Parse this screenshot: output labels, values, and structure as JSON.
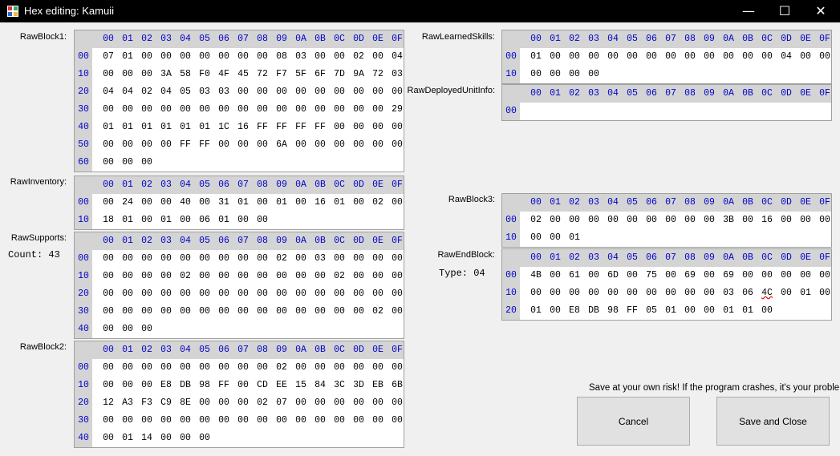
{
  "window": {
    "title": "Hex editing: Kamuii",
    "minimize": "—",
    "maximize": "☐",
    "close": "✕"
  },
  "hex_header": [
    "00",
    "01",
    "02",
    "03",
    "04",
    "05",
    "06",
    "07",
    "08",
    "09",
    "0A",
    "0B",
    "0C",
    "0D",
    "0E",
    "0F"
  ],
  "blocks": [
    {
      "id": "raw-block-1",
      "label": "RawBlock1:",
      "rows": [
        {
          "offset": "00",
          "bytes": [
            "07",
            "01",
            "00",
            "00",
            "00",
            "00",
            "00",
            "00",
            "00",
            "08",
            "03",
            "00",
            "00",
            "02",
            "00",
            "04"
          ]
        },
        {
          "offset": "10",
          "bytes": [
            "00",
            "00",
            "00",
            "3A",
            "58",
            "F0",
            "4F",
            "45",
            "72",
            "F7",
            "5F",
            "6F",
            "7D",
            "9A",
            "72",
            "03"
          ]
        },
        {
          "offset": "20",
          "bytes": [
            "04",
            "04",
            "02",
            "04",
            "05",
            "03",
            "03",
            "00",
            "00",
            "00",
            "00",
            "00",
            "00",
            "00",
            "00",
            "00"
          ]
        },
        {
          "offset": "30",
          "bytes": [
            "00",
            "00",
            "00",
            "00",
            "00",
            "00",
            "00",
            "00",
            "00",
            "00",
            "00",
            "00",
            "00",
            "00",
            "00",
            "29"
          ]
        },
        {
          "offset": "40",
          "bytes": [
            "01",
            "01",
            "01",
            "01",
            "01",
            "01",
            "1C",
            "16",
            "FF",
            "FF",
            "FF",
            "FF",
            "00",
            "00",
            "00",
            "00"
          ]
        },
        {
          "offset": "50",
          "bytes": [
            "00",
            "00",
            "00",
            "00",
            "FF",
            "FF",
            "00",
            "00",
            "00",
            "6A",
            "00",
            "00",
            "00",
            "00",
            "00",
            "00"
          ]
        },
        {
          "offset": "60",
          "bytes": [
            "00",
            "00",
            "00"
          ]
        }
      ]
    },
    {
      "id": "raw-inventory",
      "label": "RawInventory:",
      "rows": [
        {
          "offset": "00",
          "bytes": [
            "00",
            "24",
            "00",
            "00",
            "40",
            "00",
            "31",
            "01",
            "00",
            "01",
            "00",
            "16",
            "01",
            "00",
            "02",
            "00"
          ]
        },
        {
          "offset": "10",
          "bytes": [
            "18",
            "01",
            "00",
            "01",
            "00",
            "06",
            "01",
            "00",
            "00"
          ]
        }
      ]
    },
    {
      "id": "raw-supports",
      "label": "RawSupports:",
      "sub": "Count: 43",
      "rows": [
        {
          "offset": "00",
          "bytes": [
            "00",
            "00",
            "00",
            "00",
            "00",
            "00",
            "00",
            "00",
            "00",
            "02",
            "00",
            "03",
            "00",
            "00",
            "00",
            "00"
          ]
        },
        {
          "offset": "10",
          "bytes": [
            "00",
            "00",
            "00",
            "00",
            "02",
            "00",
            "00",
            "00",
            "00",
            "00",
            "00",
            "00",
            "02",
            "00",
            "00",
            "00"
          ]
        },
        {
          "offset": "20",
          "bytes": [
            "00",
            "00",
            "00",
            "00",
            "00",
            "00",
            "00",
            "00",
            "00",
            "00",
            "00",
            "00",
            "00",
            "00",
            "00",
            "00"
          ]
        },
        {
          "offset": "30",
          "bytes": [
            "00",
            "00",
            "00",
            "00",
            "00",
            "00",
            "00",
            "00",
            "00",
            "00",
            "00",
            "00",
            "00",
            "00",
            "02",
            "00"
          ]
        },
        {
          "offset": "40",
          "bytes": [
            "00",
            "00",
            "00"
          ]
        }
      ]
    },
    {
      "id": "raw-block-2",
      "label": "RawBlock2:",
      "rows": [
        {
          "offset": "00",
          "bytes": [
            "00",
            "00",
            "00",
            "00",
            "00",
            "00",
            "00",
            "00",
            "00",
            "02",
            "00",
            "00",
            "00",
            "00",
            "00",
            "00"
          ]
        },
        {
          "offset": "10",
          "bytes": [
            "00",
            "00",
            "00",
            "E8",
            "DB",
            "98",
            "FF",
            "00",
            "CD",
            "EE",
            "15",
            "84",
            "3C",
            "3D",
            "EB",
            "6B"
          ]
        },
        {
          "offset": "20",
          "bytes": [
            "12",
            "A3",
            "F3",
            "C9",
            "8E",
            "00",
            "00",
            "00",
            "02",
            "07",
            "00",
            "00",
            "00",
            "00",
            "00",
            "00"
          ]
        },
        {
          "offset": "30",
          "bytes": [
            "00",
            "00",
            "00",
            "00",
            "00",
            "00",
            "00",
            "00",
            "00",
            "00",
            "00",
            "00",
            "00",
            "00",
            "00",
            "00"
          ]
        },
        {
          "offset": "40",
          "bytes": [
            "00",
            "01",
            "14",
            "00",
            "00",
            "00"
          ]
        }
      ]
    },
    {
      "id": "raw-learned-skills",
      "label": "RawLearnedSkills:",
      "rows": [
        {
          "offset": "00",
          "bytes": [
            "01",
            "00",
            "00",
            "00",
            "00",
            "00",
            "00",
            "00",
            "00",
            "00",
            "00",
            "00",
            "00",
            "04",
            "00",
            "00"
          ]
        },
        {
          "offset": "10",
          "bytes": [
            "00",
            "00",
            "00",
            "00"
          ]
        }
      ]
    },
    {
      "id": "raw-deployed-unit-info",
      "label": "RawDeployedUnitInfo:",
      "rows": [
        {
          "offset": "00",
          "bytes": []
        }
      ]
    },
    {
      "id": "raw-block-3",
      "label": "RawBlock3:",
      "rows": [
        {
          "offset": "00",
          "bytes": [
            "02",
            "00",
            "00",
            "00",
            "00",
            "00",
            "00",
            "00",
            "00",
            "00",
            "3B",
            "00",
            "16",
            "00",
            "00",
            "00"
          ]
        },
        {
          "offset": "10",
          "bytes": [
            "00",
            "00",
            "01"
          ]
        }
      ]
    },
    {
      "id": "raw-end-block",
      "label": "RawEndBlock:",
      "sub": "Type: 04",
      "rows": [
        {
          "offset": "00",
          "bytes": [
            "4B",
            "00",
            "61",
            "00",
            "6D",
            "00",
            "75",
            "00",
            "69",
            "00",
            "69",
            "00",
            "00",
            "00",
            "00",
            "00"
          ]
        },
        {
          "offset": "10",
          "bytes": [
            "00",
            "00",
            "00",
            "00",
            "00",
            "00",
            "00",
            "00",
            "00",
            "00",
            "03",
            "06",
            "4C",
            "00",
            "01",
            "00"
          ]
        },
        {
          "offset": "20",
          "bytes": [
            "01",
            "00",
            "E8",
            "DB",
            "98",
            "FF",
            "05",
            "01",
            "00",
            "00",
            "01",
            "01",
            "00"
          ]
        }
      ]
    }
  ],
  "highlight": {
    "block": "raw-end-block",
    "row": 1,
    "col": 12
  },
  "footer": {
    "warning": "Save at your own risk! If the program crashes, it's your problem.",
    "cancel_label": "Cancel",
    "save_label": "Save and Close"
  }
}
